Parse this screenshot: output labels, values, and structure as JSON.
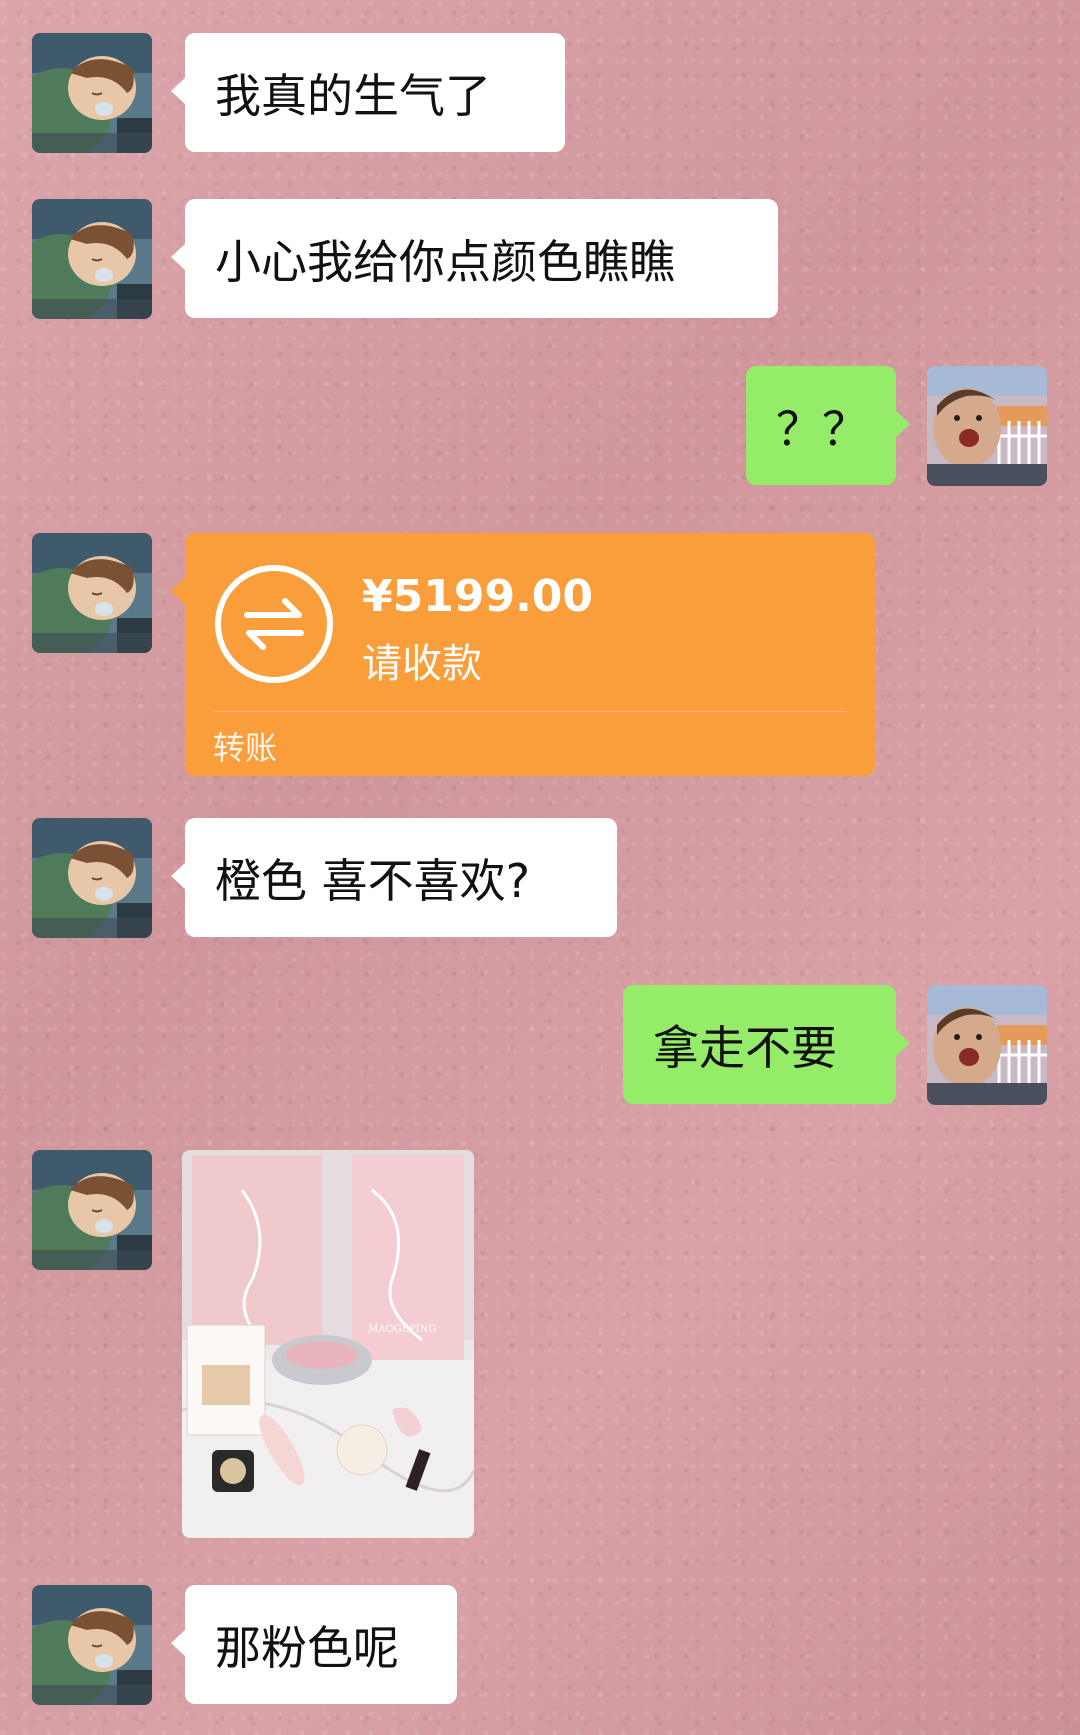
{
  "messages": [
    {
      "side": "left",
      "kind": "text",
      "text": "我真的生气了"
    },
    {
      "side": "left",
      "kind": "text",
      "text": "小心我给你点颜色瞧瞧"
    },
    {
      "side": "right",
      "kind": "text",
      "text": "？？"
    },
    {
      "side": "left",
      "kind": "transfer",
      "amount": "¥5199.00",
      "status": "请收款",
      "footer": "转账"
    },
    {
      "side": "left",
      "kind": "text",
      "text": "橙色 喜不喜欢?"
    },
    {
      "side": "right",
      "kind": "text",
      "text": "拿走不要"
    },
    {
      "side": "left",
      "kind": "image",
      "brand_text": "MAOGEPING"
    },
    {
      "side": "left",
      "kind": "text",
      "text": "那粉色呢"
    }
  ],
  "colors": {
    "background": "#d79fa4",
    "bubble_left": "#ffffff",
    "bubble_right": "#95ec69",
    "transfer": "#fa9d3b"
  },
  "icons": {
    "transfer_icon": "transfer-arrows-icon"
  }
}
